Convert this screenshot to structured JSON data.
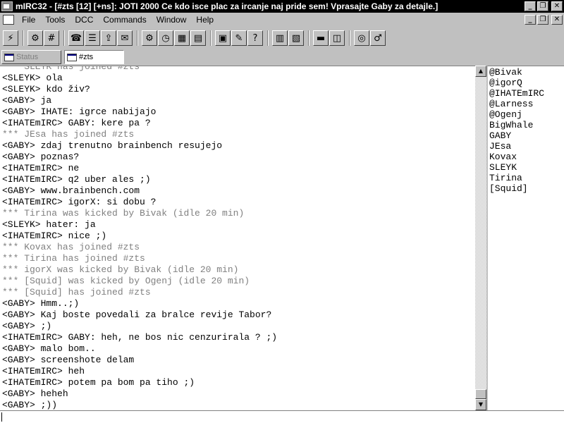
{
  "window": {
    "title": "mIRC32 - [#zts [12] [+ns]: JOTI 2000 Ce kdo isce plac za ircanje naj pride sem! Vprasajte Gaby za detajle.]",
    "controls": [
      "_",
      "❐",
      "✕"
    ]
  },
  "menu": {
    "items": [
      "File",
      "Tools",
      "DCC",
      "Commands",
      "Window",
      "Help"
    ],
    "mdi_controls": [
      "_",
      "❐",
      "✕"
    ]
  },
  "toolbar": {
    "buttons": [
      {
        "icon": "connect-icon",
        "glyph": "⚡"
      },
      {
        "icon": "options-icon",
        "glyph": "⚙"
      },
      {
        "icon": "channels-folder-icon",
        "glyph": "#"
      },
      {
        "icon": "address-book-icon",
        "glyph": "☎"
      },
      {
        "icon": "channel-list-icon",
        "glyph": "☰"
      },
      {
        "icon": "send-file-icon",
        "glyph": "⇪"
      },
      {
        "icon": "chat-icon",
        "glyph": "✉"
      },
      {
        "icon": "dcc-options-icon",
        "glyph": "⚙"
      },
      {
        "icon": "timer-icon",
        "glyph": "◷"
      },
      {
        "icon": "notify-icon",
        "glyph": "▦"
      },
      {
        "icon": "urls-icon",
        "glyph": "▤"
      },
      {
        "icon": "log-icon",
        "glyph": "▣"
      },
      {
        "icon": "script-editor-icon",
        "glyph": "✎"
      },
      {
        "icon": "help-icon",
        "glyph": "?"
      },
      {
        "icon": "tile-icon",
        "glyph": "▥"
      },
      {
        "icon": "cascade-icon",
        "glyph": "▧"
      },
      {
        "icon": "arrange-icon",
        "glyph": "▬"
      },
      {
        "icon": "windows-icon",
        "glyph": "◫"
      },
      {
        "icon": "sound-icon",
        "glyph": "◎"
      },
      {
        "icon": "about-icon",
        "glyph": "♂"
      }
    ]
  },
  "switchbar": {
    "tabs": [
      {
        "label": "Status",
        "active": false
      },
      {
        "label": "#zts",
        "active": true
      }
    ]
  },
  "chat": {
    "lines": [
      {
        "text": "*** SLEYK has joined #zts",
        "type": "event"
      },
      {
        "text": "<SLEYK> ola",
        "type": "msg"
      },
      {
        "text": "<SLEYK> kdo živ?",
        "type": "msg"
      },
      {
        "text": "<GABY> ja",
        "type": "msg"
      },
      {
        "text": "<GABY> IHATE: igrce nabijajo",
        "type": "msg"
      },
      {
        "text": "<IHATEmIRC> GABY: kere pa ?",
        "type": "msg"
      },
      {
        "text": "*** JEsa has joined #zts",
        "type": "event"
      },
      {
        "text": "<GABY> zdaj trenutno brainbench resujejo",
        "type": "msg"
      },
      {
        "text": "<GABY> poznas?",
        "type": "msg"
      },
      {
        "text": "<IHATEmIRC> ne",
        "type": "msg"
      },
      {
        "text": "<IHATEmIRC> q2 uber ales ;)",
        "type": "msg"
      },
      {
        "text": "<GABY> www.brainbench.com",
        "type": "msg"
      },
      {
        "text": "<IHATEmIRC> igorX: si dobu ?",
        "type": "msg"
      },
      {
        "text": "*** Tirina was kicked by Bivak (idle 20 min)",
        "type": "event"
      },
      {
        "text": "<SLEYK> hater: ja",
        "type": "msg"
      },
      {
        "text": "<IHATEmIRC> nice ;)",
        "type": "msg"
      },
      {
        "text": "*** Kovax has joined #zts",
        "type": "event"
      },
      {
        "text": "*** Tirina has joined #zts",
        "type": "event"
      },
      {
        "text": "*** igorX was kicked by Bivak (idle 20 min)",
        "type": "event"
      },
      {
        "text": "*** [Squid] was kicked by Ogenj (idle 20 min)",
        "type": "event"
      },
      {
        "text": "*** [Squid] has joined #zts",
        "type": "event"
      },
      {
        "text": "<GABY> Hmm..;)",
        "type": "msg"
      },
      {
        "text": "<GABY> Kaj boste povedali za bralce revije Tabor?",
        "type": "msg"
      },
      {
        "text": "<GABY> ;)",
        "type": "msg"
      },
      {
        "text": "<IHATEmIRC> GABY: heh, ne bos nic cenzurirala ? ;)",
        "type": "msg"
      },
      {
        "text": "<GABY> malo bom..",
        "type": "msg"
      },
      {
        "text": "<GABY> screenshote delam",
        "type": "msg"
      },
      {
        "text": "<IHATEmIRC> heh",
        "type": "msg"
      },
      {
        "text": "<IHATEmIRC> potem pa bom pa tiho ;)",
        "type": "msg"
      },
      {
        "text": "<GABY> heheh",
        "type": "msg"
      },
      {
        "text": "<GABY> ;))",
        "type": "msg"
      }
    ]
  },
  "scrollbar": {
    "up": "▲",
    "down": "▼",
    "position": 1.0
  },
  "nicklist": {
    "nicks": [
      "@Bivak",
      "@igorQ",
      "@IHATEmIRC",
      "@Larness",
      "@Ogenj",
      "BigWhale",
      "GABY",
      "JEsa",
      "Kovax",
      "SLEYK",
      "Tirina",
      "[Squid]"
    ]
  },
  "editbox": {
    "value": ""
  }
}
